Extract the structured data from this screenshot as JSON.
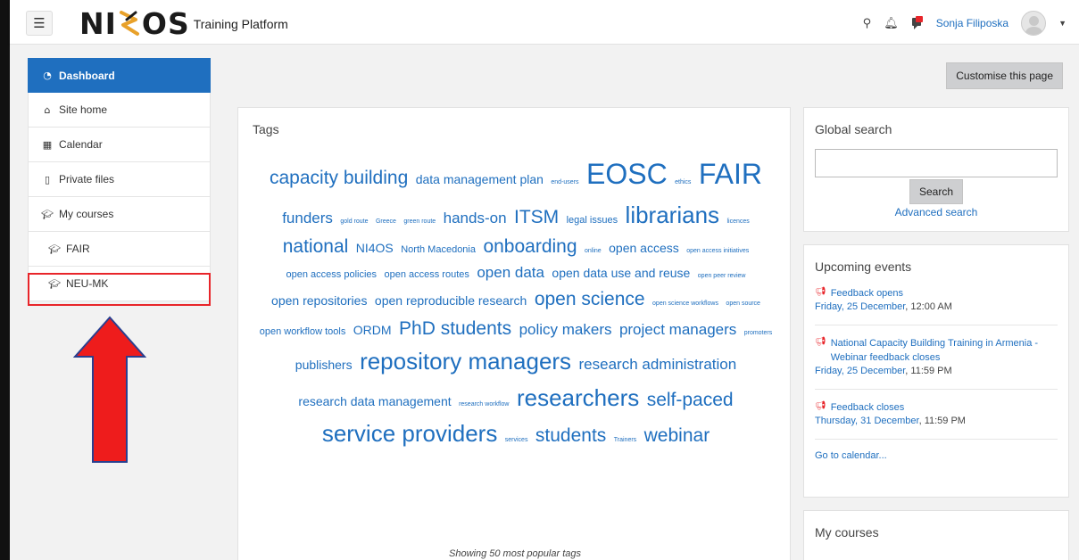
{
  "navbar": {
    "menu_icon": "hamburger-icon",
    "logo_left": "NI",
    "logo_right": "OS",
    "logo_subtitle": "Training Platform",
    "search_icon": "search-icon",
    "notification_icon": "bell-icon",
    "messages_icon": "chat-icon",
    "user_name": "Sonja Filiposka"
  },
  "sidebar": {
    "items": [
      {
        "label": "Dashboard",
        "icon": "dashboard-icon",
        "active": true
      },
      {
        "label": "Site home",
        "icon": "home-icon"
      },
      {
        "label": "Calendar",
        "icon": "calendar-icon"
      },
      {
        "label": "Private files",
        "icon": "file-icon"
      },
      {
        "label": "My courses",
        "icon": "graduation-cap-icon"
      },
      {
        "label": "FAIR",
        "icon": "graduation-cap-icon"
      },
      {
        "label": "NEU-MK",
        "icon": "graduation-cap-icon"
      }
    ],
    "highlight_color": "#e8252a"
  },
  "main": {
    "customise_label": "Customise this page",
    "tags": {
      "title": "Tags",
      "footer": "Showing 50 most popular tags",
      "items": [
        {
          "t": "capacity building",
          "s": 5
        },
        {
          "t": "data management plan",
          "s": 3
        },
        {
          "t": "end-users",
          "s": 1
        },
        {
          "t": "EOSC",
          "s": 7
        },
        {
          "t": "ethics",
          "s": 1
        },
        {
          "t": "FAIR",
          "s": 7
        },
        {
          "t": "funders",
          "s": 4
        },
        {
          "t": "gold route",
          "s": 1
        },
        {
          "t": "Greece",
          "s": 1
        },
        {
          "t": "green route",
          "s": 1
        },
        {
          "t": "hands-on",
          "s": 4
        },
        {
          "t": "ITSM",
          "s": 5
        },
        {
          "t": "legal issues",
          "s": 2
        },
        {
          "t": "librarians",
          "s": 6
        },
        {
          "t": "licences",
          "s": 1
        },
        {
          "t": "national",
          "s": 5
        },
        {
          "t": "NI4OS",
          "s": 3
        },
        {
          "t": "North Macedonia",
          "s": 2
        },
        {
          "t": "onboarding",
          "s": 5
        },
        {
          "t": "online",
          "s": 1
        },
        {
          "t": "open access",
          "s": 3
        },
        {
          "t": "open access initiatives",
          "s": 1
        },
        {
          "t": "open access policies",
          "s": 2
        },
        {
          "t": "open access routes",
          "s": 2
        },
        {
          "t": "open data",
          "s": 4
        },
        {
          "t": "open data use and reuse",
          "s": 3
        },
        {
          "t": "open peer review",
          "s": 1
        },
        {
          "t": "open repositories",
          "s": 3
        },
        {
          "t": "open reproducible research",
          "s": 3
        },
        {
          "t": "open science",
          "s": 5
        },
        {
          "t": "open science workflows",
          "s": 1
        },
        {
          "t": "open source",
          "s": 1
        },
        {
          "t": "open workflow tools",
          "s": 2
        },
        {
          "t": "ORDM",
          "s": 3
        },
        {
          "t": "PhD students",
          "s": 5
        },
        {
          "t": "policy makers",
          "s": 4
        },
        {
          "t": "project managers",
          "s": 4
        },
        {
          "t": "promoters",
          "s": 1
        },
        {
          "t": "publishers",
          "s": 3
        },
        {
          "t": "repository managers",
          "s": 6
        },
        {
          "t": "research administration",
          "s": 4
        },
        {
          "t": "research data management",
          "s": 3
        },
        {
          "t": "research workflow",
          "s": 1
        },
        {
          "t": "researchers",
          "s": 6
        },
        {
          "t": "self-paced",
          "s": 5
        },
        {
          "t": "service providers",
          "s": 6
        },
        {
          "t": "services",
          "s": 1
        },
        {
          "t": "students",
          "s": 5
        },
        {
          "t": "Trainers",
          "s": 1
        },
        {
          "t": "webinar",
          "s": 5
        }
      ]
    },
    "global_search": {
      "title": "Global search",
      "button": "Search",
      "advanced": "Advanced search"
    },
    "events": {
      "title": "Upcoming events",
      "items": [
        {
          "title": "Feedback opens",
          "date": "Friday, 25 December",
          "time": ", 12:00 AM"
        },
        {
          "title": "National Capacity Building Training in Armenia - Webinar feedback closes",
          "date": "Friday, 25 December",
          "time": ", 11:59 PM"
        },
        {
          "title": "Feedback closes",
          "date": "Thursday, 31 December",
          "time": ", 11:59 PM"
        }
      ],
      "calendar_link": "Go to calendar..."
    },
    "my_courses": {
      "title": "My courses"
    }
  }
}
